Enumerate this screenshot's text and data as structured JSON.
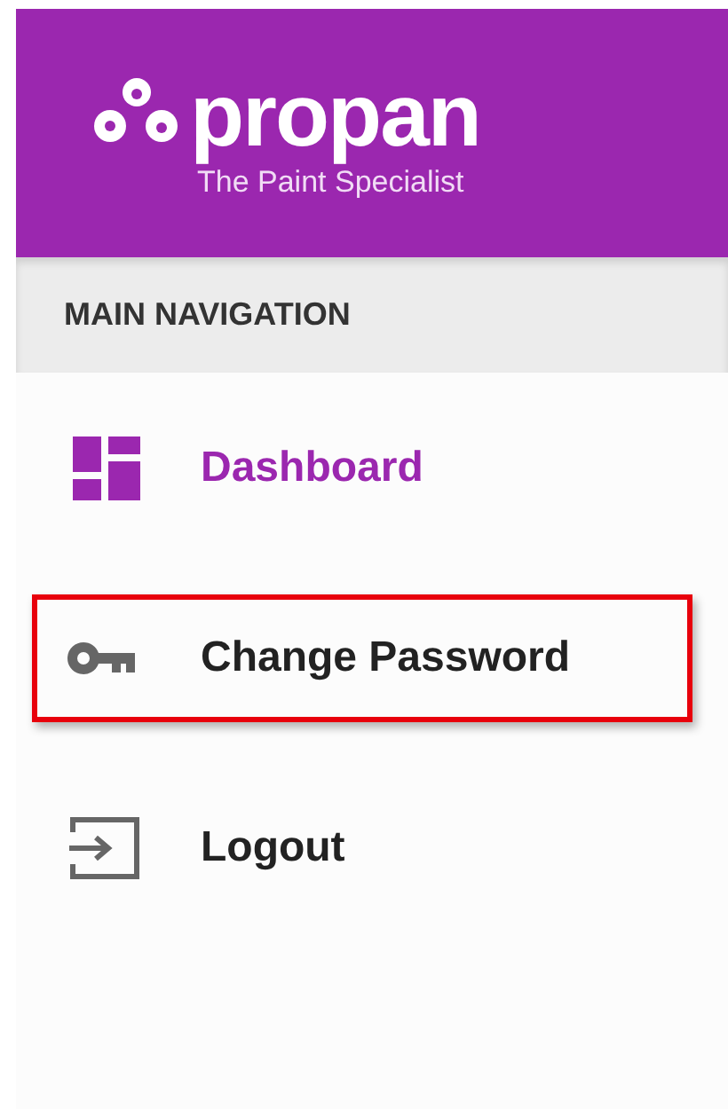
{
  "brand": {
    "name": "propan",
    "tagline": "The Paint Specialist"
  },
  "nav_header": "MAIN NAVIGATION",
  "nav_items": [
    {
      "label": "Dashboard",
      "selected": true,
      "highlighted": false
    },
    {
      "label": "Change Password",
      "selected": false,
      "highlighted": true
    },
    {
      "label": "Logout",
      "selected": false,
      "highlighted": false
    }
  ]
}
